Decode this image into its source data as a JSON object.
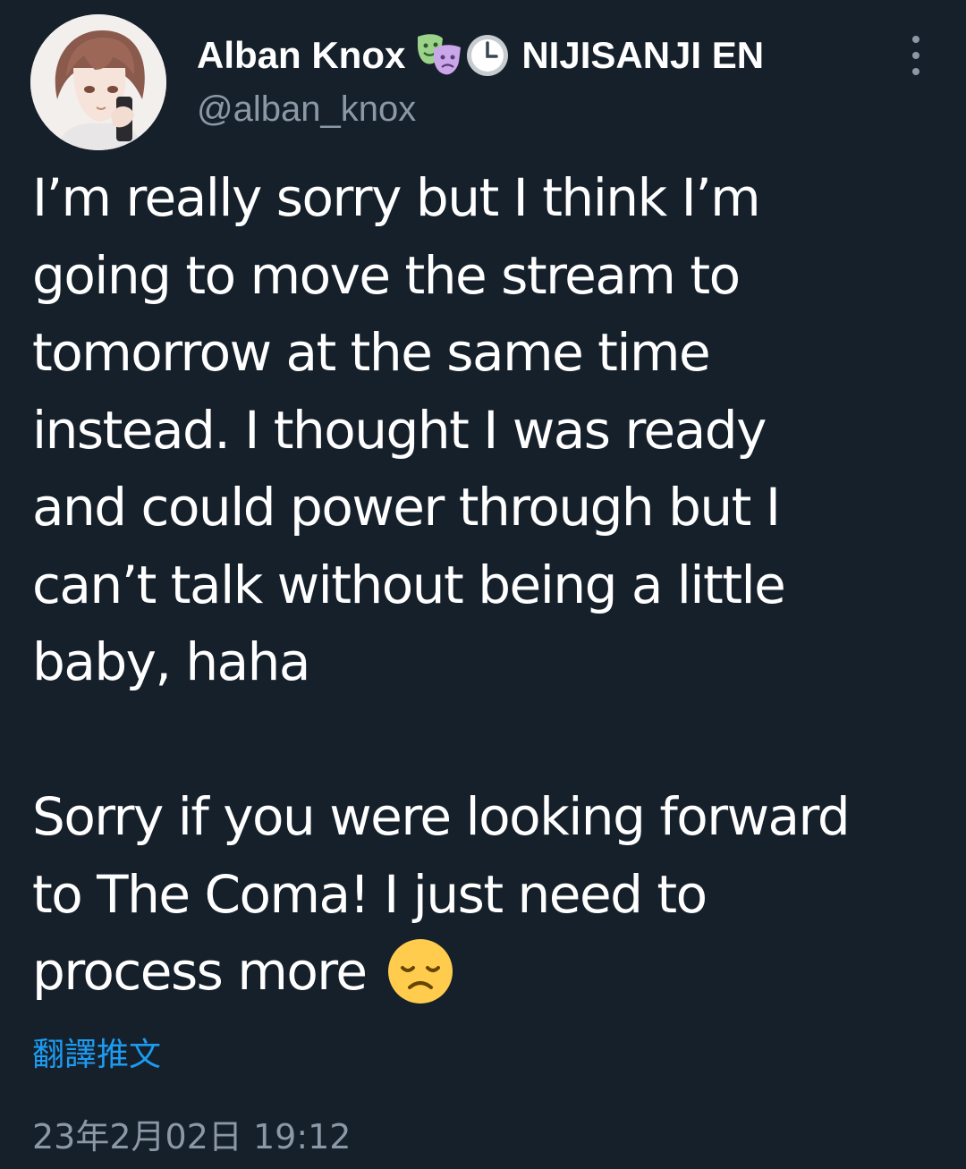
{
  "author": {
    "display_name": "Alban Knox",
    "name_emojis": [
      "performing-arts-emoji",
      "clock-emoji"
    ],
    "affiliation": "NIJISANJI EN",
    "handle": "@alban_knox"
  },
  "tweet": {
    "lines": [
      "I’m really sorry but I think I’m",
      "going to move the stream to",
      "tomorrow at the same time",
      "instead. I thought I was ready",
      "and could power through but I",
      "can’t talk without being a little",
      "baby, haha",
      "Sorry if you were looking forward",
      "to The Coma! I just need to",
      "process more"
    ],
    "trailing_emoji": "disappointed-face-emoji"
  },
  "translate_label": "翻譯推文",
  "timestamp": "23年2月02日 19:12",
  "colors": {
    "background": "#15202b",
    "text": "#ffffff",
    "secondary": "#8b98a5",
    "link": "#1d9bf0"
  }
}
